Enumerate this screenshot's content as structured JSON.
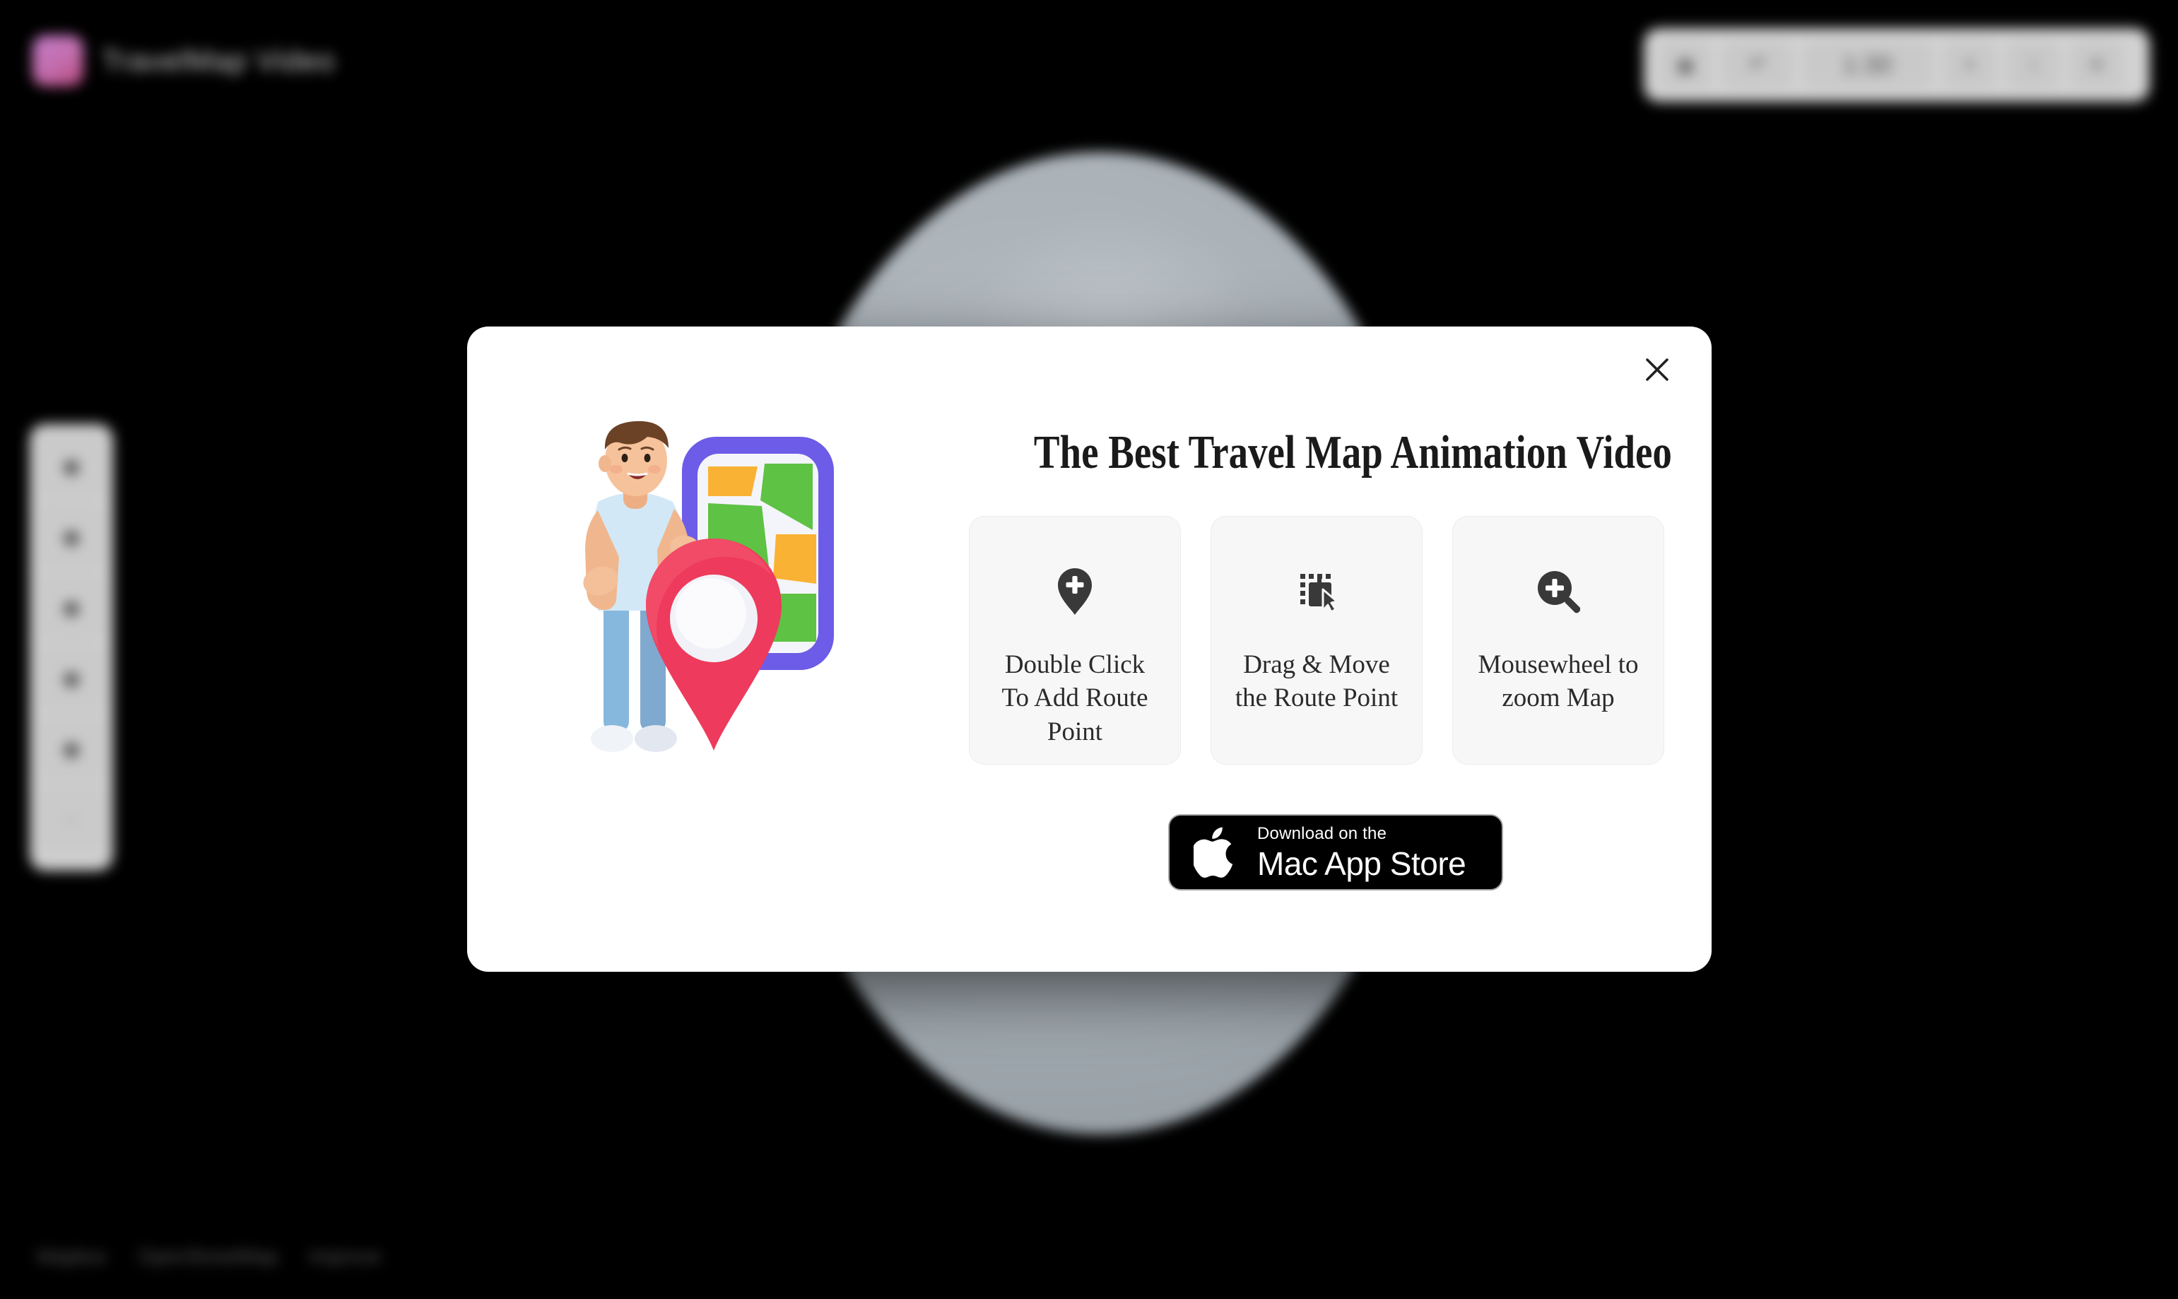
{
  "app": {
    "brand_title": "TravelMap Video",
    "logo_color": "#c36fae",
    "background_color": "#000000"
  },
  "top_toolbar": {
    "buttons": [
      {
        "name": "record-button",
        "glyph": "◉"
      },
      {
        "name": "undo-button",
        "glyph": "↶"
      },
      {
        "name": "duration-button",
        "glyph": "1:30"
      },
      {
        "name": "add-button",
        "glyph": "+"
      },
      {
        "name": "export-button",
        "glyph": "↑"
      },
      {
        "name": "settings-button",
        "glyph": "≡"
      }
    ]
  },
  "left_toolbar": {
    "buttons": [
      {
        "name": "pointer-tool",
        "glyph": "◆"
      },
      {
        "name": "route-tool",
        "glyph": "◆"
      },
      {
        "name": "marker-tool",
        "glyph": "◆"
      },
      {
        "name": "label-tool",
        "glyph": "◆"
      },
      {
        "name": "layer-tool",
        "glyph": "◆"
      },
      {
        "name": "help-tool",
        "glyph": "○"
      }
    ]
  },
  "attribution": {
    "items": [
      "Mapbox",
      "OpenStreetMap",
      "Improve"
    ]
  },
  "modal": {
    "close_label": "×",
    "title": "The Best Travel Map Animation Video",
    "illustration_name": "traveler-with-map-pin-illustration",
    "cards": [
      {
        "icon": "map-pin-plus-icon",
        "label": "Double Click To Add Route Point"
      },
      {
        "icon": "drag-select-cursor-icon",
        "label": "Drag & Move the Route Point"
      },
      {
        "icon": "magnifier-plus-icon",
        "label": "Mousewheel to zoom Map"
      }
    ],
    "store_button": {
      "icon": "apple-logo-icon",
      "line1": "Download on the",
      "line2": "Mac App Store"
    }
  },
  "colors": {
    "modal_background": "#ffffff",
    "card_background": "#f7f7f7",
    "icon_dark": "#393939",
    "title_text": "#1a1a1a",
    "store_button_background": "#000000",
    "pin_red": "#ee3a5c",
    "map_purple": "#6c5ce7",
    "map_green": "#5ec244",
    "map_orange": "#f9b233"
  }
}
